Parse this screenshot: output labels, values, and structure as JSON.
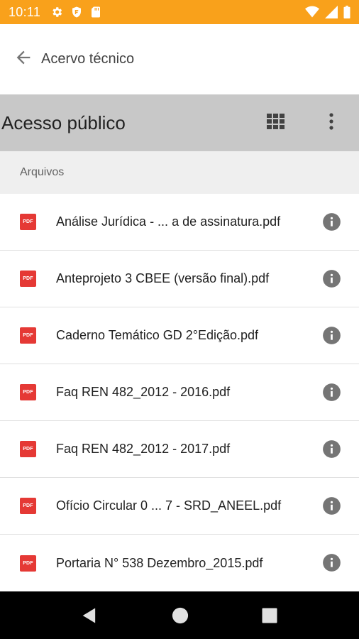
{
  "status_bar": {
    "time": "10:11",
    "left_icons": [
      "gear-icon",
      "shield-icon",
      "sd-card-icon"
    ],
    "right_icons": [
      "wifi-icon",
      "signal-icon",
      "battery-icon"
    ],
    "background": "#f9a11b"
  },
  "app_bar": {
    "back_icon": "arrow-back-icon",
    "title": "Acervo técnico"
  },
  "folder_bar": {
    "title": "Acesso público",
    "view_icon": "grid-view-icon",
    "menu_icon": "more-vert-icon",
    "background": "#c8c8c8"
  },
  "section": {
    "label": "Arquivos"
  },
  "files": [
    {
      "icon_label": "PDF",
      "name": "Análise Jurídica - ... a de assinatura.pdf"
    },
    {
      "icon_label": "PDF",
      "name": "Anteprojeto 3 CBEE (versão final).pdf"
    },
    {
      "icon_label": "PDF",
      "name": "Caderno Temático GD 2°Edição.pdf"
    },
    {
      "icon_label": "PDF",
      "name": "Faq REN 482_2012 - 2016.pdf"
    },
    {
      "icon_label": "PDF",
      "name": "Faq REN 482_2012 - 2017.pdf"
    },
    {
      "icon_label": "PDF",
      "name": "Ofício Circular 0 ... 7 - SRD_ANEEL.pdf"
    },
    {
      "icon_label": "PDF",
      "name": "Portaria N° 538 Dezembro_2015.pdf"
    }
  ],
  "nav_bar": {
    "buttons": [
      "nav-back-icon",
      "nav-home-icon",
      "nav-recents-icon"
    ]
  },
  "colors": {
    "accent": "#f9a11b",
    "pdf_red": "#e53935",
    "info_gray": "#757575"
  }
}
